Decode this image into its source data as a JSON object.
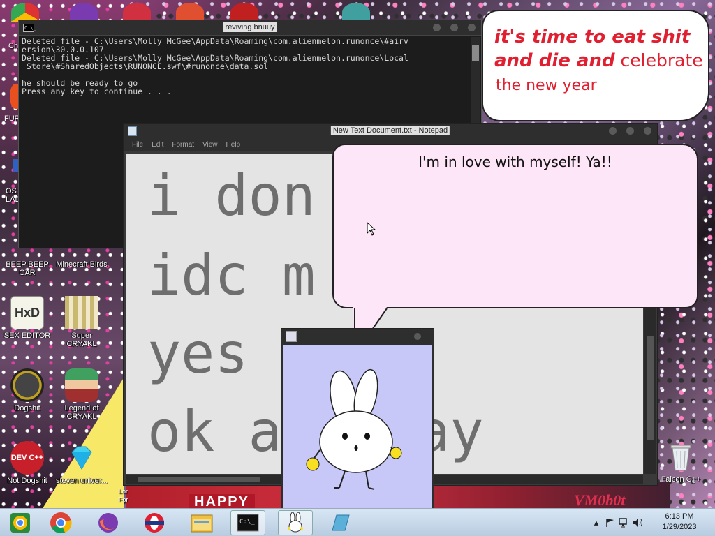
{
  "desktop": {
    "icons": [
      {
        "label": "BEEP BEEP CAR",
        "name": "beep-beep-car"
      },
      {
        "label": "Minecraft Birds",
        "name": "minecraft-birds"
      },
      {
        "label": "SEX EDITOR",
        "name": "sex-editor",
        "badge": "HxD"
      },
      {
        "label": "Super CRYAKL",
        "name": "super-cryakl"
      },
      {
        "label": "Dogshit",
        "name": "dogshit"
      },
      {
        "label": "Legend of CRYAKL",
        "name": "legend-of-cryakl"
      },
      {
        "label": "Not Dogshit",
        "name": "not-dogshit",
        "badge": "DEV C++"
      },
      {
        "label": "steven univer...",
        "name": "steven-universe"
      },
      {
        "label": "Falcon C++",
        "name": "falcon-cpp"
      }
    ],
    "partial_labels": [
      "Ch",
      "FUR",
      "OS LAD",
      "Lor For"
    ],
    "wallpaper_text": {
      "happy": "HAPPY",
      "vm": "VM0b0t"
    }
  },
  "cmd_window": {
    "title": "reviving bnuuy",
    "icon_text": "C:\\_",
    "lines": [
      "Deleted file - C:\\Users\\Molly McGee\\AppData\\Roaming\\com.alienmelon.runonce\\#airv",
      "ersion\\30.0.0.107",
      "Deleted file - C:\\Users\\Molly McGee\\AppData\\Roaming\\com.alienmelon.runonce\\Local",
      " Store\\#SharedObjects\\RUNONCE.swf\\#runonce\\data.sol",
      "",
      "he should be ready to go",
      "Press any key to continue . . ."
    ]
  },
  "notepad": {
    "title": "New Text Document.txt - Notepad",
    "menu": [
      "File",
      "Edit",
      "Format",
      "View",
      "Help"
    ],
    "lines": [
      "i don",
      "idc m",
      "yes",
      "ok a    ay"
    ]
  },
  "bubble_top": {
    "line1": "it's time to eat shit",
    "line2_bold": "and die and",
    "line2_plain": " celebrate",
    "line3": "the new year"
  },
  "bubble_pink": {
    "text": "I'm in love with myself! Ya!!"
  },
  "bunny_window": {
    "title": ""
  },
  "taskbar": {
    "apps": [
      "chrome-stack",
      "chrome",
      "firefox",
      "opera",
      "file-explorer",
      "cmd",
      "bunny",
      "generic-app"
    ],
    "time": "6:13 PM",
    "date": "1/29/2023"
  },
  "colors": {
    "bubble_red": "#e02030",
    "pink_bubble": "#fde6f8",
    "bunny_bg": "#c8c8f8",
    "taskbar": "#c8d8ea"
  }
}
